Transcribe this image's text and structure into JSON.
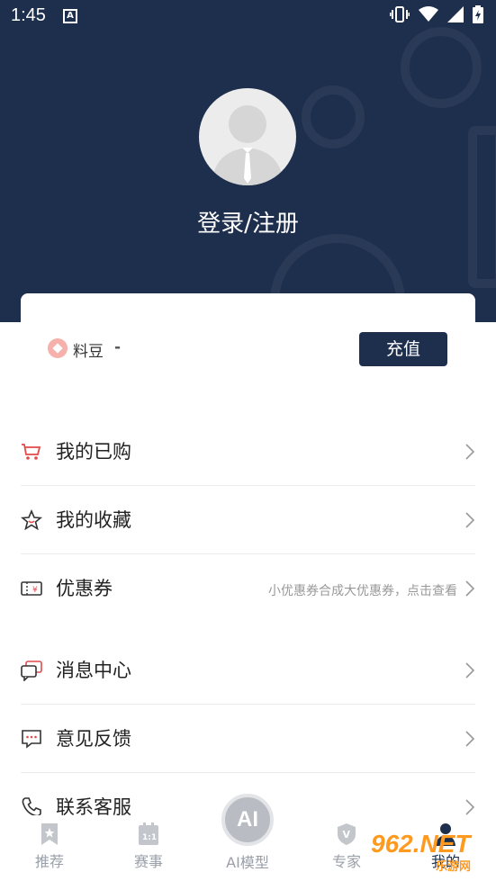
{
  "status_bar": {
    "time": "1:45",
    "a_badge": "A"
  },
  "header": {
    "login_text": "登录/注册"
  },
  "balance": {
    "label": "料豆",
    "value": "-",
    "recharge_label": "充值"
  },
  "menu": {
    "items": [
      {
        "label": "我的已购",
        "hint": "",
        "icon": "cart-icon"
      },
      {
        "label": "我的收藏",
        "hint": "",
        "icon": "star-icon"
      },
      {
        "label": "优惠券",
        "hint": "小优惠券合成大优惠券，点击查看",
        "icon": "coupon-icon"
      },
      {
        "label": "消息中心",
        "hint": "",
        "icon": "message-icon"
      },
      {
        "label": "意见反馈",
        "hint": "",
        "icon": "feedback-icon"
      },
      {
        "label": "联系客服",
        "hint": "",
        "icon": "phone-icon"
      }
    ]
  },
  "tabbar": {
    "items": [
      {
        "label": "推荐",
        "icon": "bookmark-star-icon"
      },
      {
        "label": "赛事",
        "icon": "calendar-icon"
      },
      {
        "label": "AI模型",
        "icon": "ai-icon",
        "badge": "AI"
      },
      {
        "label": "专家",
        "icon": "shield-v-icon",
        "badge": "V"
      },
      {
        "label": "我的",
        "icon": "user-icon"
      }
    ]
  },
  "watermark": {
    "brand": "962.NET",
    "sub": "乐游网"
  },
  "colors": {
    "header_bg": "#1e2f4d",
    "accent_red": "#e24a4a",
    "tab_inactive": "#9aa0a8"
  }
}
